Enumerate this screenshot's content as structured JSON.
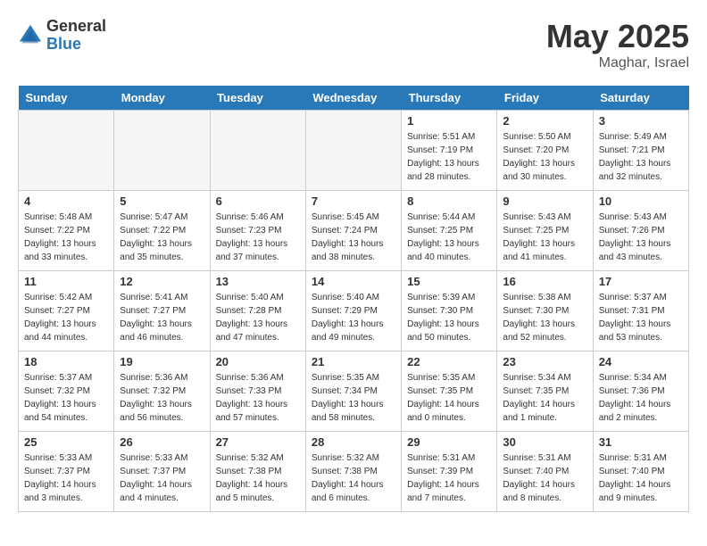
{
  "header": {
    "logo_general": "General",
    "logo_blue": "Blue",
    "month_title": "May 2025",
    "location": "Maghar, Israel"
  },
  "days_of_week": [
    "Sunday",
    "Monday",
    "Tuesday",
    "Wednesday",
    "Thursday",
    "Friday",
    "Saturday"
  ],
  "weeks": [
    [
      {
        "day": "",
        "empty": true
      },
      {
        "day": "",
        "empty": true
      },
      {
        "day": "",
        "empty": true
      },
      {
        "day": "",
        "empty": true
      },
      {
        "day": "1",
        "sunrise": "5:51 AM",
        "sunset": "7:19 PM",
        "daylight": "13 hours and 28 minutes."
      },
      {
        "day": "2",
        "sunrise": "5:50 AM",
        "sunset": "7:20 PM",
        "daylight": "13 hours and 30 minutes."
      },
      {
        "day": "3",
        "sunrise": "5:49 AM",
        "sunset": "7:21 PM",
        "daylight": "13 hours and 32 minutes."
      }
    ],
    [
      {
        "day": "4",
        "sunrise": "5:48 AM",
        "sunset": "7:22 PM",
        "daylight": "13 hours and 33 minutes."
      },
      {
        "day": "5",
        "sunrise": "5:47 AM",
        "sunset": "7:22 PM",
        "daylight": "13 hours and 35 minutes."
      },
      {
        "day": "6",
        "sunrise": "5:46 AM",
        "sunset": "7:23 PM",
        "daylight": "13 hours and 37 minutes."
      },
      {
        "day": "7",
        "sunrise": "5:45 AM",
        "sunset": "7:24 PM",
        "daylight": "13 hours and 38 minutes."
      },
      {
        "day": "8",
        "sunrise": "5:44 AM",
        "sunset": "7:25 PM",
        "daylight": "13 hours and 40 minutes."
      },
      {
        "day": "9",
        "sunrise": "5:43 AM",
        "sunset": "7:25 PM",
        "daylight": "13 hours and 41 minutes."
      },
      {
        "day": "10",
        "sunrise": "5:43 AM",
        "sunset": "7:26 PM",
        "daylight": "13 hours and 43 minutes."
      }
    ],
    [
      {
        "day": "11",
        "sunrise": "5:42 AM",
        "sunset": "7:27 PM",
        "daylight": "13 hours and 44 minutes."
      },
      {
        "day": "12",
        "sunrise": "5:41 AM",
        "sunset": "7:27 PM",
        "daylight": "13 hours and 46 minutes."
      },
      {
        "day": "13",
        "sunrise": "5:40 AM",
        "sunset": "7:28 PM",
        "daylight": "13 hours and 47 minutes."
      },
      {
        "day": "14",
        "sunrise": "5:40 AM",
        "sunset": "7:29 PM",
        "daylight": "13 hours and 49 minutes."
      },
      {
        "day": "15",
        "sunrise": "5:39 AM",
        "sunset": "7:30 PM",
        "daylight": "13 hours and 50 minutes."
      },
      {
        "day": "16",
        "sunrise": "5:38 AM",
        "sunset": "7:30 PM",
        "daylight": "13 hours and 52 minutes."
      },
      {
        "day": "17",
        "sunrise": "5:37 AM",
        "sunset": "7:31 PM",
        "daylight": "13 hours and 53 minutes."
      }
    ],
    [
      {
        "day": "18",
        "sunrise": "5:37 AM",
        "sunset": "7:32 PM",
        "daylight": "13 hours and 54 minutes."
      },
      {
        "day": "19",
        "sunrise": "5:36 AM",
        "sunset": "7:32 PM",
        "daylight": "13 hours and 56 minutes."
      },
      {
        "day": "20",
        "sunrise": "5:36 AM",
        "sunset": "7:33 PM",
        "daylight": "13 hours and 57 minutes."
      },
      {
        "day": "21",
        "sunrise": "5:35 AM",
        "sunset": "7:34 PM",
        "daylight": "13 hours and 58 minutes."
      },
      {
        "day": "22",
        "sunrise": "5:35 AM",
        "sunset": "7:35 PM",
        "daylight": "14 hours and 0 minutes."
      },
      {
        "day": "23",
        "sunrise": "5:34 AM",
        "sunset": "7:35 PM",
        "daylight": "14 hours and 1 minute."
      },
      {
        "day": "24",
        "sunrise": "5:34 AM",
        "sunset": "7:36 PM",
        "daylight": "14 hours and 2 minutes."
      }
    ],
    [
      {
        "day": "25",
        "sunrise": "5:33 AM",
        "sunset": "7:37 PM",
        "daylight": "14 hours and 3 minutes."
      },
      {
        "day": "26",
        "sunrise": "5:33 AM",
        "sunset": "7:37 PM",
        "daylight": "14 hours and 4 minutes."
      },
      {
        "day": "27",
        "sunrise": "5:32 AM",
        "sunset": "7:38 PM",
        "daylight": "14 hours and 5 minutes."
      },
      {
        "day": "28",
        "sunrise": "5:32 AM",
        "sunset": "7:38 PM",
        "daylight": "14 hours and 6 minutes."
      },
      {
        "day": "29",
        "sunrise": "5:31 AM",
        "sunset": "7:39 PM",
        "daylight": "14 hours and 7 minutes."
      },
      {
        "day": "30",
        "sunrise": "5:31 AM",
        "sunset": "7:40 PM",
        "daylight": "14 hours and 8 minutes."
      },
      {
        "day": "31",
        "sunrise": "5:31 AM",
        "sunset": "7:40 PM",
        "daylight": "14 hours and 9 minutes."
      }
    ]
  ]
}
